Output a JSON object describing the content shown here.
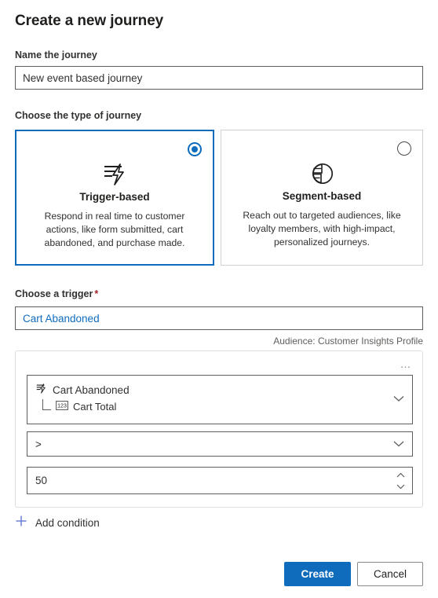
{
  "dialog": {
    "title": "Create a new journey"
  },
  "name_field": {
    "label": "Name the journey",
    "value": "New event based journey",
    "placeholder": "Name the journey"
  },
  "journey_type": {
    "label": "Choose the type of journey",
    "options": [
      {
        "id": "trigger-based",
        "title": "Trigger-based",
        "description": "Respond in real time to customer actions, like form submitted, cart abandoned, and purchase made.",
        "icon": "trigger-bolt-icon",
        "selected": true
      },
      {
        "id": "segment-based",
        "title": "Segment-based",
        "description": "Reach out to targeted audiences, like loyalty members, with high-impact, personalized journeys.",
        "icon": "pie-chart-icon",
        "selected": false
      }
    ]
  },
  "trigger_field": {
    "label": "Choose a trigger",
    "required_marker": "*",
    "value": "Cart Abandoned",
    "placeholder": "Choose a trigger",
    "audience_caption": "Audience: Customer Insights Profile"
  },
  "condition_builder": {
    "overflow_label": "…",
    "attribute_row": {
      "trigger_name": "Cart Abandoned",
      "trigger_icon": "trigger-bolt-icon",
      "attribute_name": "Cart Total",
      "attribute_icon": "number-123-icon",
      "expand_icon": "chevron-down-icon"
    },
    "operator_row": {
      "value": ">",
      "dropdown_icon": "chevron-down-icon"
    },
    "value_row": {
      "value": "50",
      "stepper_icon": "stepper-up-down-icon"
    },
    "add_condition_label": "Add condition",
    "add_condition_icon": "plus-icon"
  },
  "footer": {
    "primary_label": "Create",
    "secondary_label": "Cancel"
  },
  "colors": {
    "accent": "#0f6cbd",
    "required": "#a4262c",
    "text": "#201f1e",
    "muted": "#605e5c",
    "border": "#605e5c",
    "soft_border": "#e1dfdd"
  }
}
